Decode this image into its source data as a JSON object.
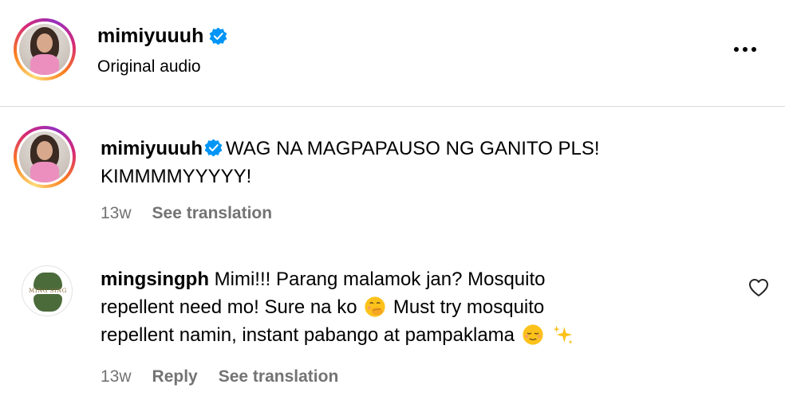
{
  "header": {
    "username": "mimiyuuuh",
    "subtitle": "Original audio",
    "more_icon": "more-horizontal-icon"
  },
  "caption": {
    "username": "mimiyuuuh",
    "text": "WAG NA MAGPAPAUSO NG GANITO PLS!",
    "text_line2": "KIMMMMYYYYY!",
    "time": "13w",
    "see_translation": "See translation"
  },
  "comment": {
    "username": "mingsingph",
    "text_line1": "Mimi!!! Parang malamok jan? Mosquito",
    "text_line2a": "repellent need mo! Sure na ko",
    "text_line2b": "Must try mosquito",
    "text_line3": "repellent namin, instant pabango at pampaklama",
    "time": "13w",
    "reply": "Reply",
    "see_translation": "See translation",
    "avatar_text": "MING SING"
  },
  "colors": {
    "verified_blue": "#0095f6",
    "meta_gray": "#737373",
    "divider": "#dbdbdb"
  }
}
